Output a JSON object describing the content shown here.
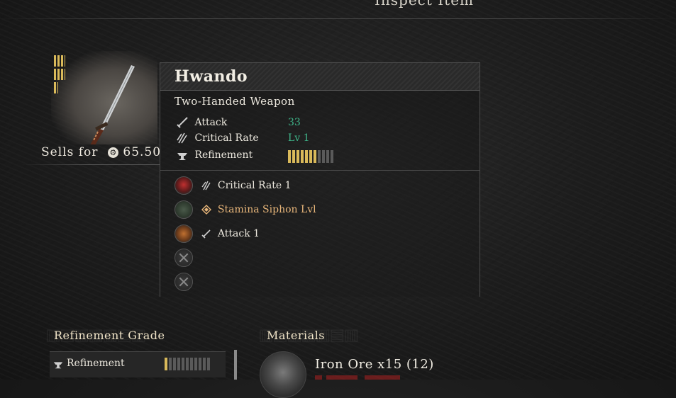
{
  "header": {
    "title": "Inspect Item"
  },
  "item": {
    "name": "Hwando",
    "type": "Two-Handed Weapon",
    "rarity": 3,
    "sells_label": "Sells for",
    "sell_price": "65.50",
    "stats": [
      {
        "icon": "sword-icon",
        "label": "Attack",
        "value": "33"
      },
      {
        "icon": "claw-icon",
        "label": "Critical Rate",
        "value": "Lv 1"
      },
      {
        "icon": "anvil-icon",
        "label": "Refinement",
        "value": ""
      }
    ],
    "refinement_level": 7,
    "refinement_max": 11,
    "slots": [
      {
        "socket": "red",
        "icon": "claw-icon",
        "text": "Critical Rate 1",
        "highlight": false
      },
      {
        "socket": "green",
        "icon": "diamond-icon",
        "text": "Stamina Siphon Lvl",
        "highlight": true
      },
      {
        "socket": "orange",
        "icon": "sword-icon",
        "text": "Attack 1",
        "highlight": false
      },
      {
        "socket": "empty",
        "icon": "",
        "text": "",
        "highlight": false
      },
      {
        "socket": "empty",
        "icon": "",
        "text": "",
        "highlight": false
      }
    ]
  },
  "refinement_grade": {
    "title": "Refinement Grade",
    "label": "Refinement",
    "level": 1,
    "max": 11
  },
  "materials": {
    "title": "Materials",
    "items": [
      {
        "name": "Iron Ore x15 (12)"
      }
    ]
  },
  "colors": {
    "accent_gold": "#d9b95a",
    "stat_green": "#3fb58a",
    "slot_gold": "#e8b67a"
  }
}
